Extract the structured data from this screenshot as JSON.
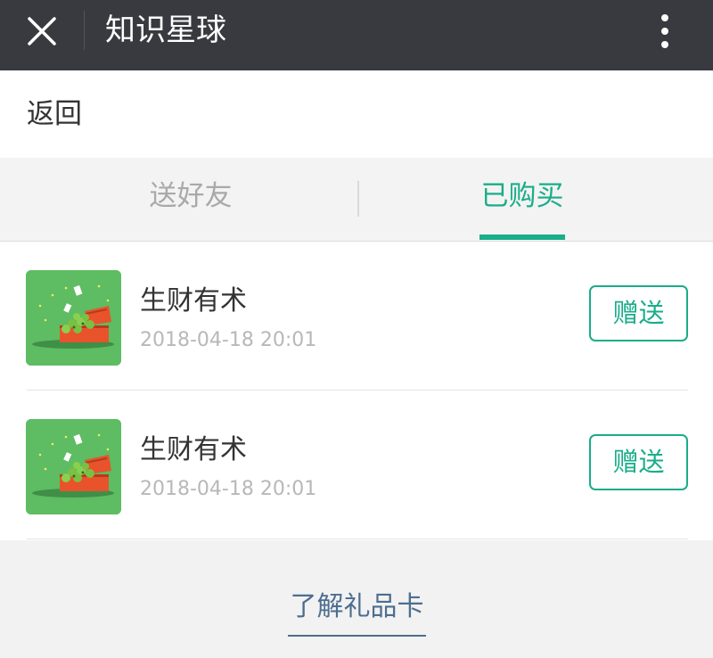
{
  "titlebar": {
    "title": "知识星球",
    "close_icon": "close-icon",
    "more_icon": "more-vertical-icon"
  },
  "back": {
    "label": "返回"
  },
  "tabs": [
    {
      "label": "送好友",
      "active": false
    },
    {
      "label": "已购买",
      "active": true
    }
  ],
  "items": [
    {
      "name": "生财有术",
      "time": "2018-04-18 20:01",
      "button": "赠送",
      "thumb_icon": "treasure-chest-icon"
    },
    {
      "name": "生财有术",
      "time": "2018-04-18 20:01",
      "button": "赠送",
      "thumb_icon": "treasure-chest-icon"
    }
  ],
  "footer": {
    "link": "了解礼品卡"
  },
  "colors": {
    "accent": "#1aad8a",
    "titlebar": "#393a3f",
    "link": "#4d6e8f",
    "thumb_bg": "#5ebc62"
  }
}
